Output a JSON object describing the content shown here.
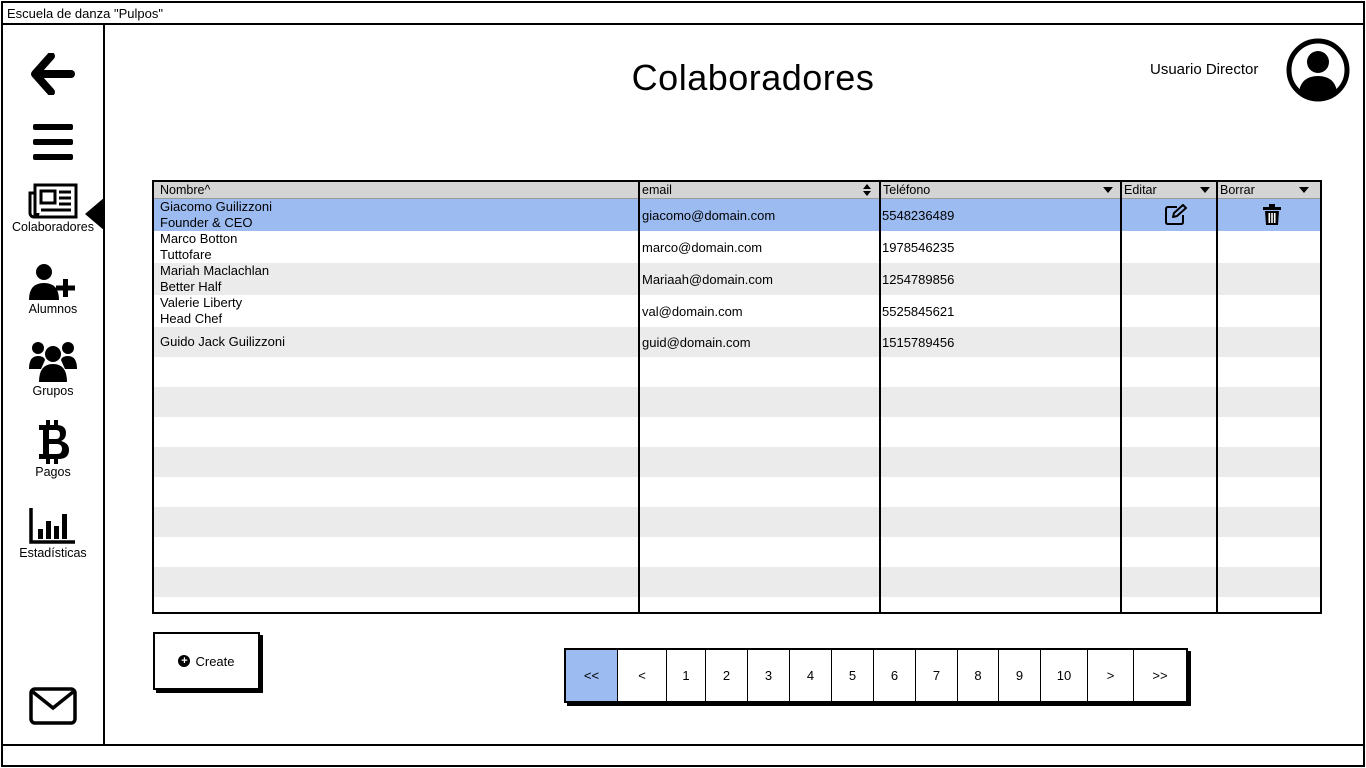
{
  "app": {
    "title": "Escuela de danza \"Pulpos\""
  },
  "header": {
    "title": "Colaboradores",
    "user_name": "Usuario Director"
  },
  "sidebar": {
    "items": [
      {
        "label": "Colaboradores",
        "icon": "newspaper-icon"
      },
      {
        "label": "Alumnos",
        "icon": "user-plus-icon"
      },
      {
        "label": "Grupos",
        "icon": "users-icon"
      },
      {
        "label": "Pagos",
        "icon": "bitcoin-icon"
      },
      {
        "label": "Estadísticas",
        "icon": "bar-chart-icon"
      }
    ],
    "active": "Colaboradores"
  },
  "table": {
    "columns": [
      "Nombre^",
      "email",
      "Teléfono",
      "Editar",
      "Borrar"
    ],
    "rows": [
      {
        "name": "Giacomo Guilizzoni",
        "role": "Founder & CEO",
        "email": "giacomo@domain.com",
        "phone": "5548236489",
        "selected": true
      },
      {
        "name": "Marco Botton",
        "role": "Tuttofare",
        "email": "marco@domain.com",
        "phone": "1978546235",
        "selected": false
      },
      {
        "name": "Mariah Maclachlan",
        "role": "Better Half",
        "email": "Mariaah@domain.com",
        "phone": "1254789856",
        "selected": false
      },
      {
        "name": "Valerie Liberty",
        "role": "Head Chef",
        "email": "val@domain.com",
        "phone": "5525845621",
        "selected": false
      },
      {
        "name": "Guido Jack Guilizzoni",
        "role": "",
        "email": "guid@domain.com",
        "phone": "1515789456",
        "selected": false
      }
    ]
  },
  "actions": {
    "create_label": "Create"
  },
  "pagination": {
    "pages": [
      "<<",
      "<",
      "1",
      "2",
      "3",
      "4",
      "5",
      "6",
      "7",
      "8",
      "9",
      "10",
      ">",
      ">>"
    ],
    "active": "<<"
  },
  "colors": {
    "selection": "#9cbcf1",
    "header_bg": "#d4d4d4",
    "stripe": "#ebebeb"
  }
}
